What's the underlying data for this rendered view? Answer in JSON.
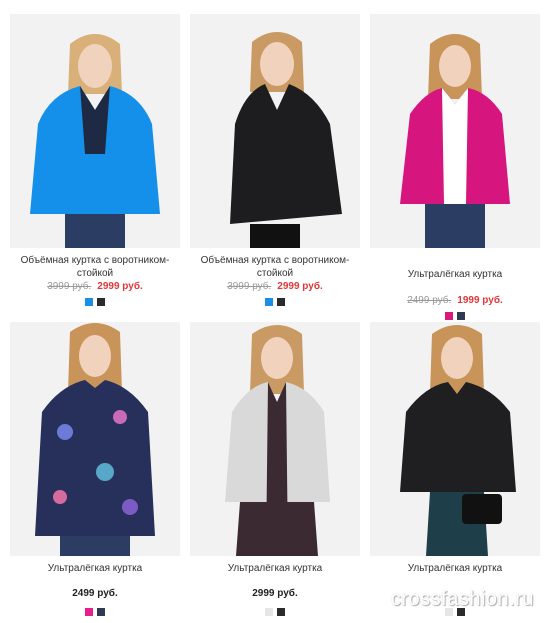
{
  "products": [
    {
      "name": "Объёмная куртка с воротником-стойкой",
      "old_price": "3999 руб.",
      "price": "2999 руб.",
      "colors": [
        "#1a8fe6",
        "#2b2b2b"
      ],
      "jacket_color": "#1590ea"
    },
    {
      "name": "Объёмная куртка с воротником-стойкой",
      "old_price": "3999 руб.",
      "price": "2999 руб.",
      "colors": [
        "#1a8fe6",
        "#2b2b2b"
      ],
      "jacket_color": "#1d1d1f"
    },
    {
      "name": "Ультралёгкая куртка",
      "old_price": "2499 руб.",
      "price": "1999 руб.",
      "colors": [
        "#d81b7a",
        "#2f3b55"
      ],
      "jacket_color": "#d6157f"
    },
    {
      "name": "Ультралёгкая куртка",
      "price": "2499 руб.",
      "colors": [
        "#e91e8c",
        "#2f3b55"
      ],
      "jacket_color": "#27305a"
    },
    {
      "name": "Ультралёгкая куртка",
      "price": "2999 руб.",
      "colors": [
        "#e6e6e6",
        "#2b2b2b"
      ],
      "jacket_color": "#d9d9d9"
    },
    {
      "name": "Ультралёгкая куртка",
      "price": "",
      "colors": [
        "#e6e6e6",
        "#2b2b2b"
      ],
      "jacket_color": "#1f1f21"
    }
  ],
  "watermark": "crossfashion.ru"
}
